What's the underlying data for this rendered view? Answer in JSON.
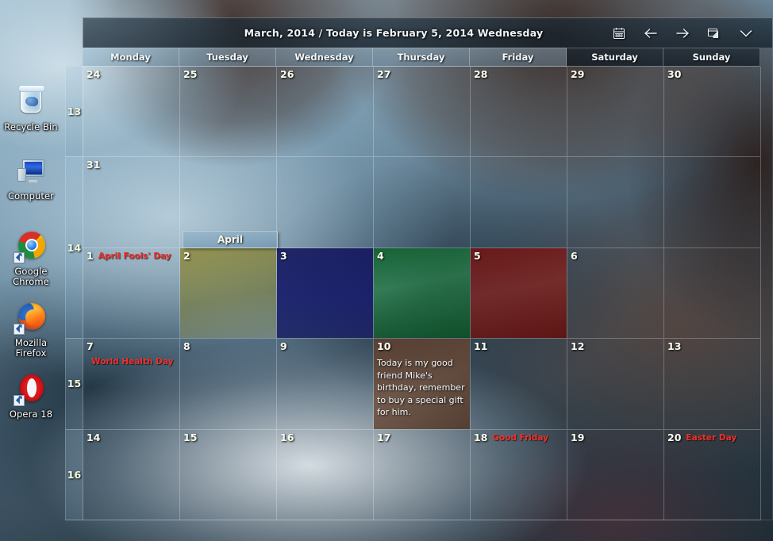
{
  "desktop": {
    "icons": [
      {
        "label": "Recycle Bin",
        "icon": "recycle-bin-icon",
        "shortcut": false
      },
      {
        "label": "Computer",
        "icon": "computer-icon",
        "shortcut": false
      },
      {
        "label": "Google\nChrome",
        "label_line1": "Google",
        "label_line2": "Chrome",
        "icon": "google-chrome-icon",
        "shortcut": true
      },
      {
        "label": "Mozilla\nFirefox",
        "label_line1": "Mozilla",
        "label_line2": "Firefox",
        "icon": "mozilla-firefox-icon",
        "shortcut": true
      },
      {
        "label": "Opera 18",
        "label_line1": "Opera 18",
        "label_line2": "",
        "icon": "opera-icon",
        "shortcut": true
      }
    ]
  },
  "calendar": {
    "title": "March, 2014 / Today is February 5, 2014 Wednesday",
    "toolbar": [
      {
        "name": "calendar-view-icon",
        "tooltip": "Calendar"
      },
      {
        "name": "previous-month-arrow-icon",
        "tooltip": "Previous"
      },
      {
        "name": "next-month-arrow-icon",
        "tooltip": "Next"
      },
      {
        "name": "restore-window-icon",
        "tooltip": "Restore"
      },
      {
        "name": "chevron-down-icon",
        "tooltip": "More"
      }
    ],
    "day_headers": [
      {
        "label": "Monday",
        "weekend": false
      },
      {
        "label": "Tuesday",
        "weekend": false
      },
      {
        "label": "Wednesday",
        "weekend": false
      },
      {
        "label": "Thursday",
        "weekend": false
      },
      {
        "label": "Friday",
        "weekend": false
      },
      {
        "label": "Saturday",
        "weekend": true
      },
      {
        "label": "Sunday",
        "weekend": true
      }
    ],
    "week_numbers": [
      "13",
      "14",
      "15",
      "16"
    ],
    "month_tag": "April",
    "colors": {
      "holiday_text": "#f0302a",
      "day_number_text": "#fdfef0",
      "header_text": "#f2f7fa"
    },
    "weeks": [
      {
        "week": "13",
        "days": [
          {
            "num": "24",
            "holiday": "",
            "note": "",
            "tint": ""
          },
          {
            "num": "25",
            "holiday": "",
            "note": "",
            "tint": ""
          },
          {
            "num": "26",
            "holiday": "",
            "note": "",
            "tint": ""
          },
          {
            "num": "27",
            "holiday": "",
            "note": "",
            "tint": ""
          },
          {
            "num": "28",
            "holiday": "",
            "note": "",
            "tint": ""
          },
          {
            "num": "29",
            "holiday": "",
            "note": "",
            "tint": ""
          },
          {
            "num": "30",
            "holiday": "",
            "note": "",
            "tint": ""
          }
        ]
      },
      {
        "week": "14",
        "days": [
          {
            "num": "31",
            "holiday": "",
            "note": "",
            "tint": ""
          },
          {
            "num": "",
            "holiday": "",
            "note": "",
            "tint": ""
          },
          {
            "num": "",
            "holiday": "",
            "note": "",
            "tint": ""
          },
          {
            "num": "",
            "holiday": "",
            "note": "",
            "tint": ""
          },
          {
            "num": "",
            "holiday": "",
            "note": "",
            "tint": ""
          },
          {
            "num": "",
            "holiday": "",
            "note": "",
            "tint": ""
          },
          {
            "num": "",
            "holiday": "",
            "note": "",
            "tint": ""
          }
        ]
      },
      {
        "week": "",
        "days": [
          {
            "num": "1",
            "holiday": "April Fools' Day",
            "note": "",
            "tint": ""
          },
          {
            "num": "2",
            "holiday": "",
            "note": "",
            "tint": "tint-olive"
          },
          {
            "num": "3",
            "holiday": "",
            "note": "",
            "tint": "tint-navy"
          },
          {
            "num": "4",
            "holiday": "",
            "note": "",
            "tint": "tint-green"
          },
          {
            "num": "5",
            "holiday": "",
            "note": "",
            "tint": "tint-red"
          },
          {
            "num": "6",
            "holiday": "",
            "note": "",
            "tint": ""
          },
          {
            "num": "",
            "holiday": "",
            "note": "",
            "tint": ""
          }
        ]
      },
      {
        "week": "15",
        "days": [
          {
            "num": "7",
            "holiday": "World Health Day",
            "note": "",
            "tint": ""
          },
          {
            "num": "8",
            "holiday": "",
            "note": "",
            "tint": ""
          },
          {
            "num": "9",
            "holiday": "",
            "note": "",
            "tint": ""
          },
          {
            "num": "10",
            "holiday": "",
            "note": "Today is my good friend Mike's birthday, remember to buy a special gift for him.",
            "tint": "tint-brown"
          },
          {
            "num": "11",
            "holiday": "",
            "note": "",
            "tint": ""
          },
          {
            "num": "12",
            "holiday": "",
            "note": "",
            "tint": ""
          },
          {
            "num": "13",
            "holiday": "",
            "note": "",
            "tint": ""
          }
        ]
      },
      {
        "week": "16",
        "days": [
          {
            "num": "14",
            "holiday": "",
            "note": "",
            "tint": ""
          },
          {
            "num": "15",
            "holiday": "",
            "note": "",
            "tint": ""
          },
          {
            "num": "16",
            "holiday": "",
            "note": "",
            "tint": ""
          },
          {
            "num": "17",
            "holiday": "",
            "note": "",
            "tint": ""
          },
          {
            "num": "18",
            "holiday": "Good Friday",
            "note": "",
            "tint": ""
          },
          {
            "num": "19",
            "holiday": "",
            "note": "",
            "tint": ""
          },
          {
            "num": "20",
            "holiday": "Easter Day",
            "note": "",
            "tint": ""
          }
        ]
      }
    ]
  }
}
